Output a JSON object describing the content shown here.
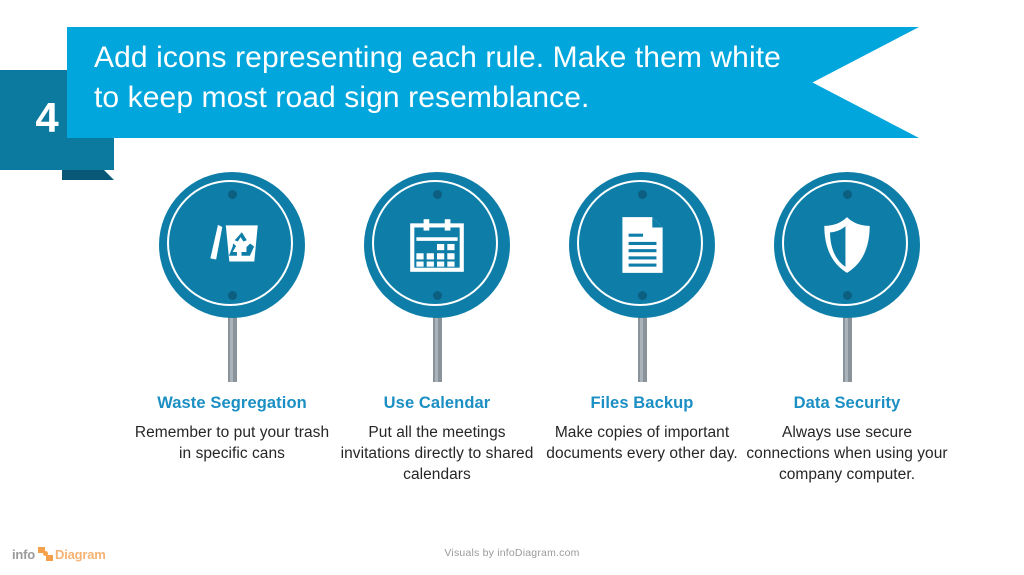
{
  "header": {
    "badge_number": "4",
    "title": "Add icons representing each rule. Make them white to keep most road sign resemblance.",
    "banner_color": "#00a6dc",
    "badge_color": "#0c7a9e",
    "fold_color": "#0a5878"
  },
  "theme": {
    "sign_color": "#0e7ea8",
    "screw_color": "#0c5f80",
    "post_color": "#8a929a",
    "caption_title_color": "#1b8fc4",
    "caption_body_color": "#262626",
    "icon_color": "#ffffff"
  },
  "items": [
    {
      "icon": "recycle-bin-icon",
      "title": "Waste Segregation",
      "body": "Remember to put your trash in specific cans"
    },
    {
      "icon": "calendar-icon",
      "title": "Use Calendar",
      "body": "Put all the meetings invitations directly to shared calendars"
    },
    {
      "icon": "document-icon",
      "title": "Files Backup",
      "body": "Make copies of important documents every other day."
    },
    {
      "icon": "shield-icon",
      "title": "Data Security",
      "body": "Always use secure connections when using your company computer."
    }
  ],
  "footer": {
    "logo_info": "info",
    "logo_diagram": "Diagram",
    "credit": "Visuals by infoDiagram.com"
  }
}
